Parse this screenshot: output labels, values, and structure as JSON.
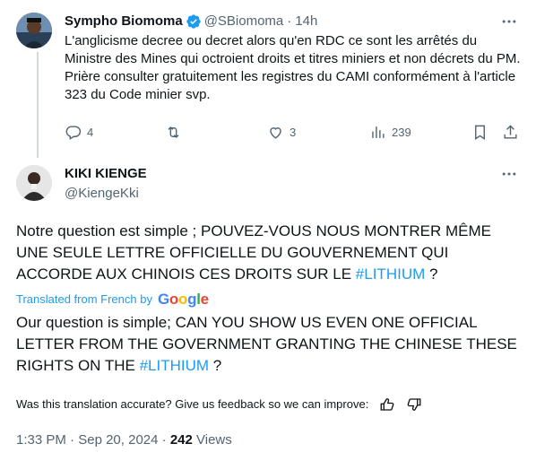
{
  "reply": {
    "author_name": "Sympho Biomoma",
    "handle": "@SBiomoma",
    "separator": "·",
    "time": "14h",
    "text": "L'anglicisme decree ou decret alors qu'en RDC ce sont les arrêtés du Ministre des Mines qui octroient droits et titres miniers et non décrets du PM. Prière consulter gratuitement les registres du CAMI conformément à l'article 323 du Code minier svp.",
    "replies": "4",
    "likes": "3",
    "views": "239"
  },
  "tweet": {
    "author_name": "KIKI KIENGE",
    "handle": "@KiengeKki",
    "text_before_hashtag": "Notre question est simple ; POUVEZ-VOUS NOUS MONTRER MÊME UNE SEULE LETTRE OFFICIELLE DU GOUVERNEMENT QUI ACCORDE AUX CHINOIS CES DROITS SUR LE ",
    "hashtag": "#LITHIUM",
    "text_after_hashtag": " ?",
    "translated_label": "Translated from French by",
    "google_letters": [
      "G",
      "o",
      "o",
      "g",
      "l",
      "e"
    ],
    "translation_before_hashtag": "Our question is simple; CAN YOU SHOW US EVEN ONE OFFICIAL LETTER FROM THE GOVERNMENT GRANTING THE CHINESE THESE RIGHTS ON THE ",
    "translation_hashtag": "#LITHIUM",
    "translation_after_hashtag": " ?",
    "feedback_prompt": "Was this translation accurate? Give us feedback so we can improve:",
    "time": "1:33 PM",
    "date_separator": "·",
    "date": "Sep 20, 2024",
    "views_separator": "·",
    "views_count": "242",
    "views_label": "Views"
  },
  "colors": {
    "link": "#1d9bf0",
    "text": "#0f1419",
    "secondary": "#536471",
    "verified": "#1d9bf0"
  },
  "icons": {
    "verified": "verified-badge-icon",
    "more": "more-dots-icon",
    "reply": "reply-bubble-icon",
    "retweet": "retweet-icon",
    "like": "heart-icon",
    "views": "views-bar-chart-icon",
    "bookmark": "bookmark-icon",
    "share": "share-icon",
    "thumbs_up": "thumbs-up-icon",
    "thumbs_down": "thumbs-down-icon"
  }
}
